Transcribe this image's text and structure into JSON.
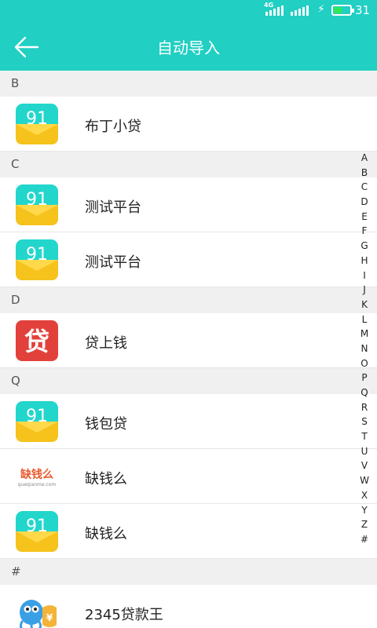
{
  "status_bar": {
    "network": "4G",
    "battery": "31"
  },
  "app_bar": {
    "title": "自动导入"
  },
  "sections": [
    {
      "letter": "B",
      "items": [
        {
          "name": "布丁小贷",
          "icon": "app-91-icon"
        }
      ]
    },
    {
      "letter": "C",
      "items": [
        {
          "name": "测试平台",
          "icon": "app-91-icon"
        },
        {
          "name": "测试平台",
          "icon": "app-91-icon"
        }
      ]
    },
    {
      "letter": "D",
      "items": [
        {
          "name": "贷上钱",
          "icon": "dai-logo-icon"
        }
      ]
    },
    {
      "letter": "Q",
      "items": [
        {
          "name": "钱包贷",
          "icon": "app-91-icon"
        },
        {
          "name": "缺钱么",
          "icon": "queqianme-logo-icon"
        },
        {
          "name": "缺钱么",
          "icon": "app-91-icon"
        }
      ]
    },
    {
      "letter": "#",
      "items": [
        {
          "name": "2345贷款王",
          "icon": "mascot-icon"
        }
      ]
    }
  ],
  "logos": {
    "dai": "贷",
    "queqianme": "缺钱么",
    "queqianme_sub": "queqianme.com",
    "yen": "¥"
  },
  "index_letters": [
    "A",
    "B",
    "C",
    "D",
    "E",
    "F",
    "G",
    "H",
    "I",
    "J",
    "K",
    "L",
    "M",
    "N",
    "O",
    "P",
    "Q",
    "R",
    "S",
    "T",
    "U",
    "V",
    "W",
    "X",
    "Y",
    "Z",
    "#"
  ],
  "colors": {
    "accent": "#21cfc3",
    "section_bg": "#f0f0f0",
    "icon_top": "#22d6cc",
    "icon_bottom": "#f6c21c",
    "dai_red": "#e2413b"
  }
}
